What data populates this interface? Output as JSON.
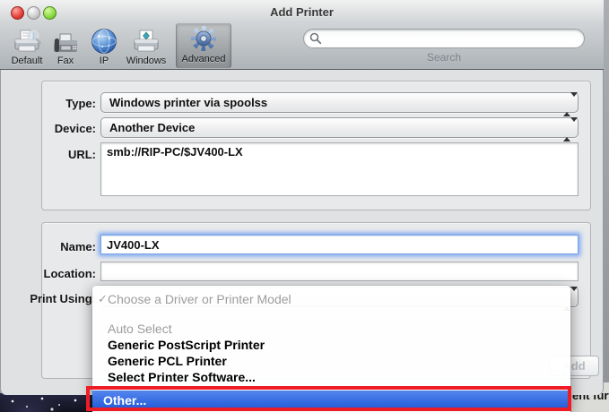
{
  "window": {
    "title": "Add Printer"
  },
  "toolbar": {
    "items": [
      {
        "label": "Default",
        "icon": "printer-search-icon"
      },
      {
        "label": "Fax",
        "icon": "fax-icon"
      },
      {
        "label": "IP",
        "icon": "globe-icon"
      },
      {
        "label": "Windows",
        "icon": "printer-windows-icon"
      },
      {
        "label": "Advanced",
        "icon": "gear-icon",
        "selected": true
      }
    ],
    "search_label": "Search"
  },
  "form": {
    "type": {
      "label": "Type:",
      "value": "Windows printer via spoolss"
    },
    "device": {
      "label": "Device:",
      "value": "Another Device"
    },
    "url": {
      "label": "URL:",
      "value": "smb://RIP-PC/$JV400-LX"
    },
    "name": {
      "label": "Name:",
      "value": "JV400-LX"
    },
    "location": {
      "label": "Location:",
      "value": ""
    },
    "print_using": {
      "label": "Print Using:"
    }
  },
  "driver_menu": {
    "checkmark": "✓",
    "items": [
      {
        "label": "Choose a Driver or Printer Model",
        "state": "checked-disabled"
      },
      {
        "label": "Auto Select",
        "state": "disabled"
      },
      {
        "label": "Generic PostScript Printer",
        "state": "normal"
      },
      {
        "label": "Generic PCL Printer",
        "state": "normal"
      },
      {
        "label": "Select Printer Software...",
        "state": "normal"
      },
      {
        "label": "Other...",
        "state": "highlighted"
      }
    ]
  },
  "buttons": {
    "add": "Add"
  },
  "background": {
    "clipped_text": "ent furth"
  },
  "colors": {
    "selection_blue": "#2d63dd",
    "annotation_red": "#ee1c25",
    "focus_ring": "#78a4e8",
    "menu_disabled_text": "#9c9c9c"
  }
}
